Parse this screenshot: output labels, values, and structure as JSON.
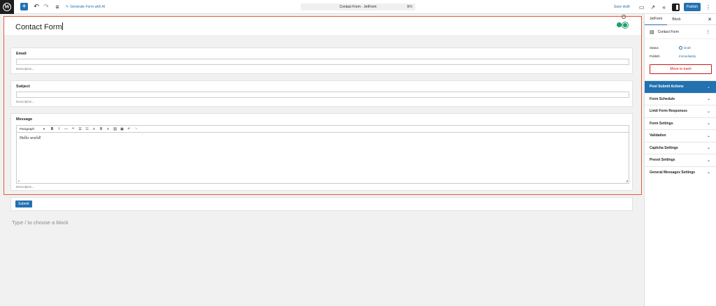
{
  "topbar": {
    "add_icon": "plus-icon",
    "ai_link": "Generate Form with AI",
    "command": "Contact Form · JetForm",
    "shortcut": "⌘K",
    "save_draft": "Save draft",
    "publish": "Publish"
  },
  "form": {
    "title": "Contact Form",
    "fields": [
      {
        "label": "Email",
        "description": "Description..."
      },
      {
        "label": "Subject",
        "description": "Description..."
      },
      {
        "label": "Message",
        "description": "Description..."
      }
    ],
    "editor": {
      "format": "Paragraph",
      "content": "Hello world!",
      "path": "p"
    },
    "submit": "Submit",
    "placeholder": "Type / to choose a block"
  },
  "sidebar": {
    "tabs": [
      "JetForm",
      "Block"
    ],
    "document": "Contact Form",
    "status_label": "Status",
    "status_value": "Draft",
    "publish_label": "Publish",
    "publish_value": "Immediately",
    "trash": "Move to trash",
    "panels": [
      "Post Submit Actions",
      "Form Schedule",
      "Limit Form Responses",
      "Form Settings",
      "Validation",
      "Captcha Settings",
      "Preset Settings",
      "General Messages Settings"
    ]
  },
  "colors": {
    "accent": "#2271b1",
    "selection": "#e35b3b",
    "danger": "#cc1818",
    "green": "#1a9e6f"
  }
}
